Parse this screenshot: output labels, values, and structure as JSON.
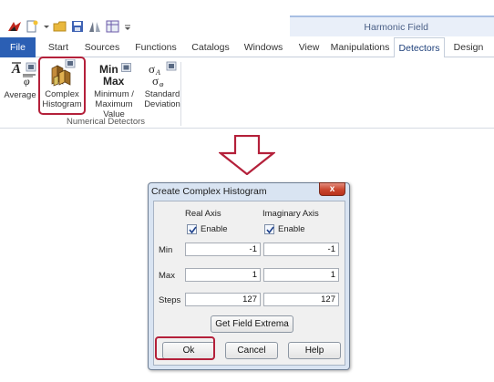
{
  "ribbon_band": {
    "title": "Harmonic Field"
  },
  "tabs": [
    {
      "label": "File"
    },
    {
      "label": "Start"
    },
    {
      "label": "Sources"
    },
    {
      "label": "Functions"
    },
    {
      "label": "Catalogs"
    },
    {
      "label": "Windows"
    },
    {
      "label": "View"
    },
    {
      "label": "Manipulations"
    },
    {
      "label": "Detectors"
    },
    {
      "label": "Design"
    }
  ],
  "ribbon": {
    "buttons": [
      {
        "label": "Average",
        "icon": "average-icon"
      },
      {
        "label": "Complex Histogram",
        "line1": "Complex",
        "line2": "Histogram",
        "icon": "histogram-icon"
      },
      {
        "label": "Minimum / Maximum Value",
        "line1": "Minimum /",
        "line2": "Maximum Value",
        "icon": "min-max-icon"
      },
      {
        "label": "Standard Deviation",
        "line1": "Standard",
        "line2": "Deviation",
        "icon": "std-dev-icon"
      }
    ],
    "minmax_glyph": {
      "top": "Min",
      "bottom": "Max"
    },
    "group_label": "Numerical Detectors"
  },
  "dialog": {
    "title": "Create Complex Histogram",
    "close": "x",
    "real_axis": {
      "label": "Real Axis",
      "enable_label": "Enable",
      "enabled": true
    },
    "imag_axis": {
      "label": "Imaginary Axis",
      "enable_label": "Enable",
      "enabled": true
    },
    "rows": [
      {
        "label": "Min",
        "real": "-1",
        "imag": "-1"
      },
      {
        "label": "Max",
        "real": "1",
        "imag": "1"
      },
      {
        "label": "Steps",
        "real": "127",
        "imag": "127"
      }
    ],
    "extrema_button": "Get Field Extrema",
    "ok": "Ok",
    "cancel": "Cancel",
    "help": "Help"
  },
  "colors": {
    "file_tab": "#2b5fb4",
    "highlight": "#b4203a",
    "close_button": "#c9452d"
  }
}
